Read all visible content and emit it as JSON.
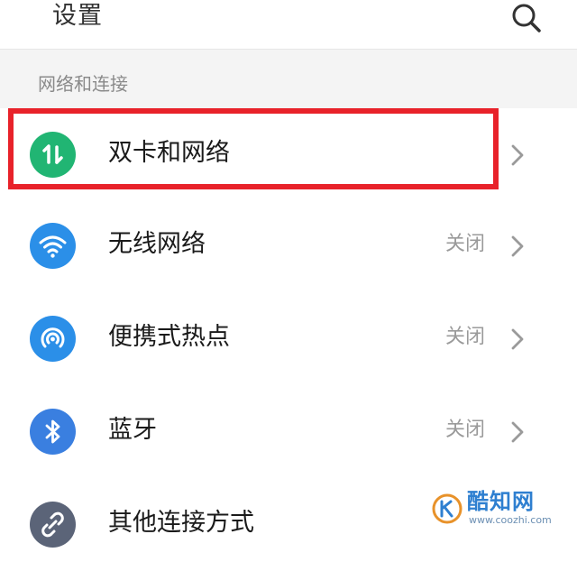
{
  "header": {
    "title": "设置"
  },
  "section": {
    "title": "网络和连接"
  },
  "items": [
    {
      "label": "双卡和网络",
      "status": "",
      "icon": "swap-arrows-icon",
      "icon_color": "#21b573",
      "highlighted": true
    },
    {
      "label": "无线网络",
      "status": "关闭",
      "icon": "wifi-icon",
      "icon_color": "#2b8fe8"
    },
    {
      "label": "便携式热点",
      "status": "关闭",
      "icon": "hotspot-icon",
      "icon_color": "#2b8fe8"
    },
    {
      "label": "蓝牙",
      "status": "关闭",
      "icon": "bluetooth-icon",
      "icon_color": "#3a7fe0"
    },
    {
      "label": "其他连接方式",
      "status": "",
      "icon": "link-icon",
      "icon_color": "#5b6478"
    }
  ],
  "annotation": {
    "color": "#e8222a"
  },
  "watermark": {
    "name": "酷知网",
    "url": "www.coozhi.com"
  }
}
